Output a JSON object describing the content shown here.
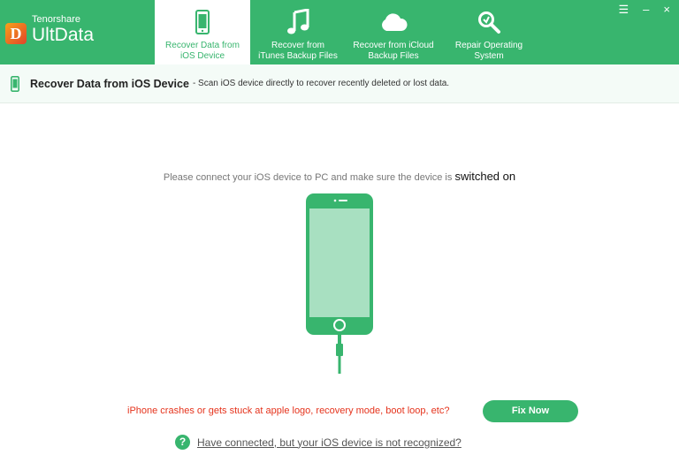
{
  "app": {
    "brand": "Tenorshare",
    "product": "UltData",
    "logo_letter": "D"
  },
  "tabs": [
    {
      "label": "Recover Data from\niOS Device",
      "icon": "iphone-icon",
      "active": true
    },
    {
      "label": "Recover from\niTunes Backup Files",
      "icon": "music-note-icon",
      "active": false
    },
    {
      "label": "Recover from iCloud\nBackup Files",
      "icon": "cloud-icon",
      "active": false
    },
    {
      "label": "Repair Operating\nSystem",
      "icon": "wrench-magnifier-icon",
      "active": false
    }
  ],
  "window_controls": {
    "menu": "☰",
    "minimize": "–",
    "close": "×"
  },
  "subheader": {
    "title": "Recover Data from iOS Device",
    "description": "- Scan iOS device directly to recover recently deleted or lost data."
  },
  "main": {
    "instruction": "Please connect your iOS device to PC and make sure the device is",
    "instruction_strong": "switched on",
    "warning": "iPhone crashes or gets stuck at apple logo, recovery mode, boot loop, etc?",
    "fix_button": "Fix Now",
    "help_icon": "?",
    "help_link": "Have connected, but your iOS device is not recognized?"
  },
  "colors": {
    "accent": "#38b56e",
    "warning": "#e5331c"
  }
}
